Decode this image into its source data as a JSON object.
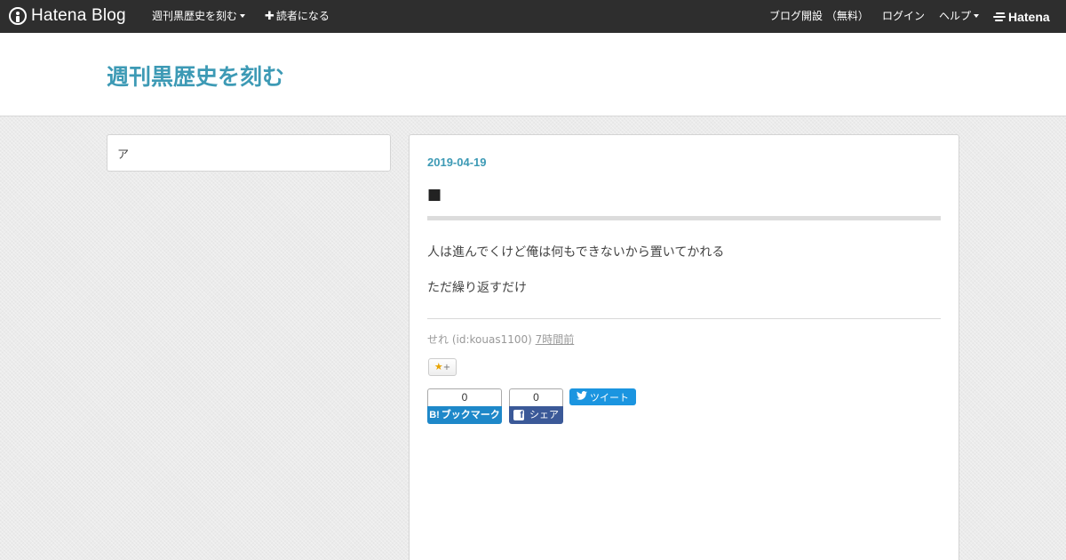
{
  "header": {
    "logo_text": "Hatena Blog",
    "blog_menu_label": "週刊黒歴史を刻む",
    "subscribe_label": "読者になる",
    "open_blog_label": "ブログ開設 （無料）",
    "login_label": "ログイン",
    "help_label": "ヘルプ",
    "hatena_label": "Hatena"
  },
  "blog": {
    "title": "週刊黒歴史を刻む",
    "accent_color": "#3d9ab5"
  },
  "sidebar": {
    "text": "ア"
  },
  "entry": {
    "date": "2019-04-19",
    "title": "■",
    "paragraphs": [
      "人は進んでくけど俺は何もできないから置いてかれる",
      "ただ繰り返すだけ"
    ],
    "author": "せれ (id:kouas1100)",
    "time_ago": "7時間前"
  },
  "share": {
    "star_label": "+",
    "hatena_bookmark_count": "0",
    "hatena_bookmark_label": "ブックマーク",
    "facebook_count": "0",
    "facebook_label": "シェア",
    "tweet_label": "ツイート"
  }
}
